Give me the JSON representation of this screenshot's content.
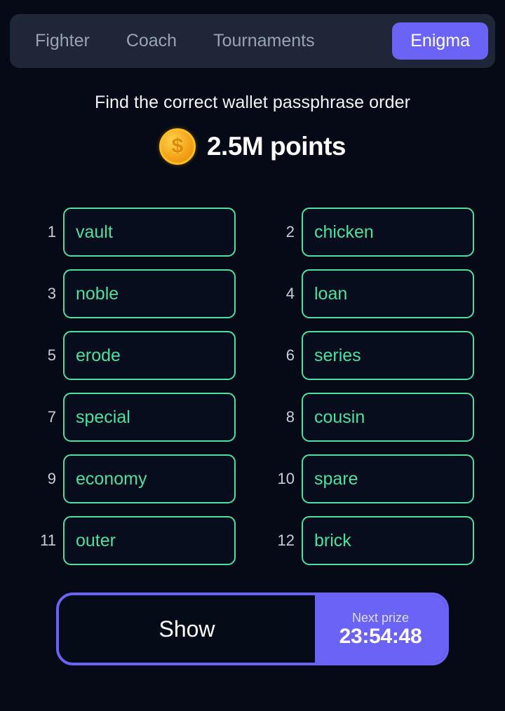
{
  "colors": {
    "page_bg": "#050a16",
    "tabbar_bg": "#1e2638",
    "accent_purple": "#6b63f5",
    "tile_green": "#4ee0a0",
    "coin_gold": "#f6a71d",
    "muted_text": "#9aa3b5",
    "index_text": "#c8cdd8"
  },
  "tabs": [
    {
      "label": "Fighter",
      "active": false
    },
    {
      "label": "Coach",
      "active": false
    },
    {
      "label": "Tournaments",
      "active": false
    },
    {
      "label": "Enigma",
      "active": true
    }
  ],
  "header": {
    "instruction": "Find the correct wallet passphrase order",
    "coin_icon": "coin-dollar-icon",
    "coin_glyph": "$",
    "points": "2.5M points"
  },
  "words": [
    {
      "index": "1",
      "word": "vault"
    },
    {
      "index": "2",
      "word": "chicken"
    },
    {
      "index": "3",
      "word": "noble"
    },
    {
      "index": "4",
      "word": "loan"
    },
    {
      "index": "5",
      "word": "erode"
    },
    {
      "index": "6",
      "word": "series"
    },
    {
      "index": "7",
      "word": "special"
    },
    {
      "index": "8",
      "word": "cousin"
    },
    {
      "index": "9",
      "word": "economy"
    },
    {
      "index": "10",
      "word": "spare"
    },
    {
      "index": "11",
      "word": "outer"
    },
    {
      "index": "12",
      "word": "brick"
    }
  ],
  "footer": {
    "show_label": "Show",
    "prize_label": "Next prize",
    "prize_timer": "23:54:48"
  }
}
